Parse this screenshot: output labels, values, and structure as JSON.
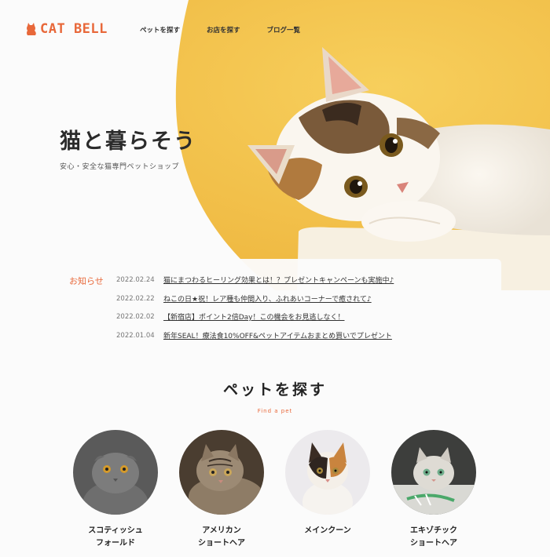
{
  "brand": {
    "name": "CAT BELL",
    "accent": "#e8683a"
  },
  "nav": {
    "items": [
      "ペットを探す",
      "お店を探す",
      "ブログ一覧"
    ]
  },
  "hero": {
    "title": "猫と暮らそう",
    "subtitle": "安心・安全な猫専門ペットショップ",
    "bg_color": "#f3c453"
  },
  "news": {
    "label": "お知らせ",
    "items": [
      {
        "date": "2022.02.24",
        "text": "猫にまつわるヒーリング効果とは！？プレゼントキャンペーンも実施中♪"
      },
      {
        "date": "2022.02.22",
        "text": "ねこの日★祝！レア種も仲間入り、ふれあいコーナーで癒されて♪"
      },
      {
        "date": "2022.02.02",
        "text": "【新宿店】ポイント2倍Day！この機会をお見逃しなく！"
      },
      {
        "date": "2022.01.04",
        "text": "新年SEAL！療法食10%OFF&ペットアイテムおまとめ買いでプレゼント"
      }
    ]
  },
  "find_pet": {
    "title": "ペットを探す",
    "subtitle": "Find a pet",
    "breeds": [
      {
        "line1": "スコティッシュ",
        "line2": "フォールド",
        "icon": "scottish-fold-photo"
      },
      {
        "line1": "アメリカン",
        "line2": "ショートヘア",
        "icon": "american-shorthair-photo"
      },
      {
        "line1": "メインクーン",
        "line2": "",
        "icon": "maine-coon-photo"
      },
      {
        "line1": "エキゾチック",
        "line2": "ショートヘア",
        "icon": "exotic-shorthair-photo"
      }
    ]
  }
}
